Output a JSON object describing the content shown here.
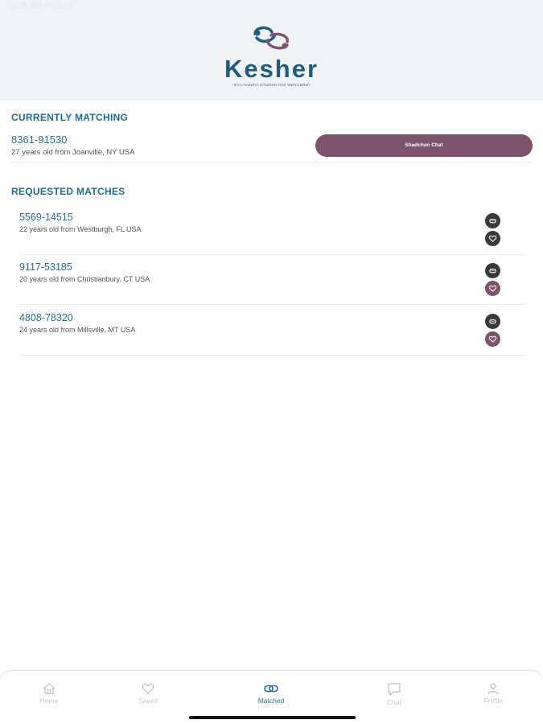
{
  "status_bar": {
    "time": "10:35 AM Fri Jul 8"
  },
  "brand": {
    "name": "Kesher",
    "tagline": "לשמש בחשאי אחת מהפעולות החשובות ביותר",
    "logo_icon": "linked-rings-logo",
    "colors": {
      "teal": "#1e5d80",
      "plum": "#7d526d"
    }
  },
  "currently_matching": {
    "title": "CURRENTLY MATCHING",
    "match": {
      "id": "8361-91530",
      "description": "27 years old from Joanville, NY USA"
    },
    "chat_button_label": "Shadchan Chat"
  },
  "requested_matches": {
    "title": "REQUESTED MATCHES",
    "items": [
      {
        "id": "5569-14515",
        "description": "22 years old from Westburgh, FL USA",
        "chat_icon": "chat-icon",
        "heart_icon": "heart-icon",
        "heart_color": "#3a3a3a"
      },
      {
        "id": "9117-53185",
        "description": "20 years old from Christianbury, CT USA",
        "chat_icon": "chat-icon",
        "heart_icon": "heart-icon",
        "heart_color": "#7d526d"
      },
      {
        "id": "4808-78320",
        "description": "24 years old from Millsville, MT USA",
        "chat_icon": "chat-icon",
        "heart_icon": "heart-icon",
        "heart_color": "#7d526d"
      }
    ]
  },
  "tabbar": {
    "active": "Matched",
    "active_color": "#2b6f99",
    "tabs": [
      {
        "label": "Home",
        "icon": "home-icon"
      },
      {
        "label": "Saved",
        "icon": "heart-icon"
      },
      {
        "label": "Matched",
        "icon": "link-icon"
      },
      {
        "label": "Chat",
        "icon": "chat-bubble-icon"
      },
      {
        "label": "Profile",
        "icon": "person-icon"
      }
    ]
  }
}
